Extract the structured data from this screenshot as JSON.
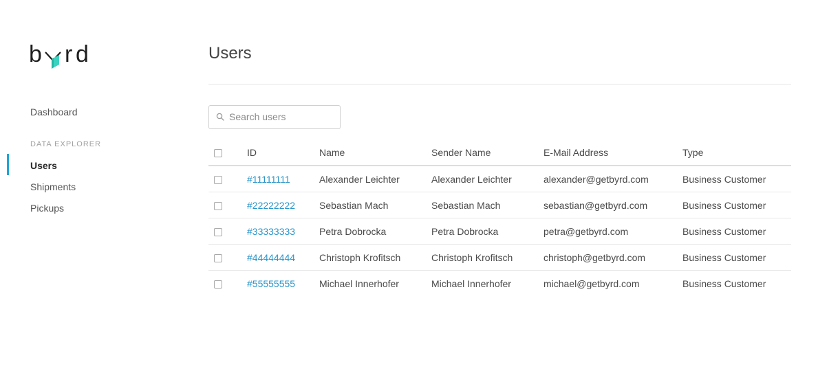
{
  "brand": {
    "name": "byrd",
    "logo_letters": [
      "b",
      "y",
      "r",
      "d"
    ],
    "accent_color": "#3ad3c0"
  },
  "sidebar": {
    "items": [
      {
        "label": "Dashboard"
      }
    ],
    "section_label": "DATA EXPLORER",
    "section_items": [
      {
        "label": "Users",
        "active": true
      },
      {
        "label": "Shipments",
        "active": false
      },
      {
        "label": "Pickups",
        "active": false
      }
    ],
    "active_color": "#21a5d6"
  },
  "page": {
    "title": "Users"
  },
  "search": {
    "placeholder": "Search users",
    "value": "",
    "icon": "search-icon"
  },
  "table": {
    "columns": [
      "ID",
      "Name",
      "Sender Name",
      "E-Mail Address",
      "Type"
    ],
    "rows": [
      {
        "id": "#11111111",
        "name": "Alexander Leichter",
        "sender": "Alexander Leichter",
        "email": "alexander@getbyrd.com",
        "type": "Business Customer"
      },
      {
        "id": "#22222222",
        "name": "Sebastian Mach",
        "sender": "Sebastian Mach",
        "email": "sebastian@getbyrd.com",
        "type": "Business Customer"
      },
      {
        "id": "#33333333",
        "name": "Petra Dobrocka",
        "sender": "Petra Dobrocka",
        "email": "petra@getbyrd.com",
        "type": "Business Customer"
      },
      {
        "id": "#44444444",
        "name": "Christoph Krofitsch",
        "sender": "Christoph Krofitsch",
        "email": "christoph@getbyrd.com",
        "type": "Business Customer"
      },
      {
        "id": "#55555555",
        "name": "Michael Innerhofer",
        "sender": "Michael Innerhofer",
        "email": "michael@getbyrd.com",
        "type": "Business Customer"
      }
    ],
    "link_color": "#2a95c9"
  }
}
